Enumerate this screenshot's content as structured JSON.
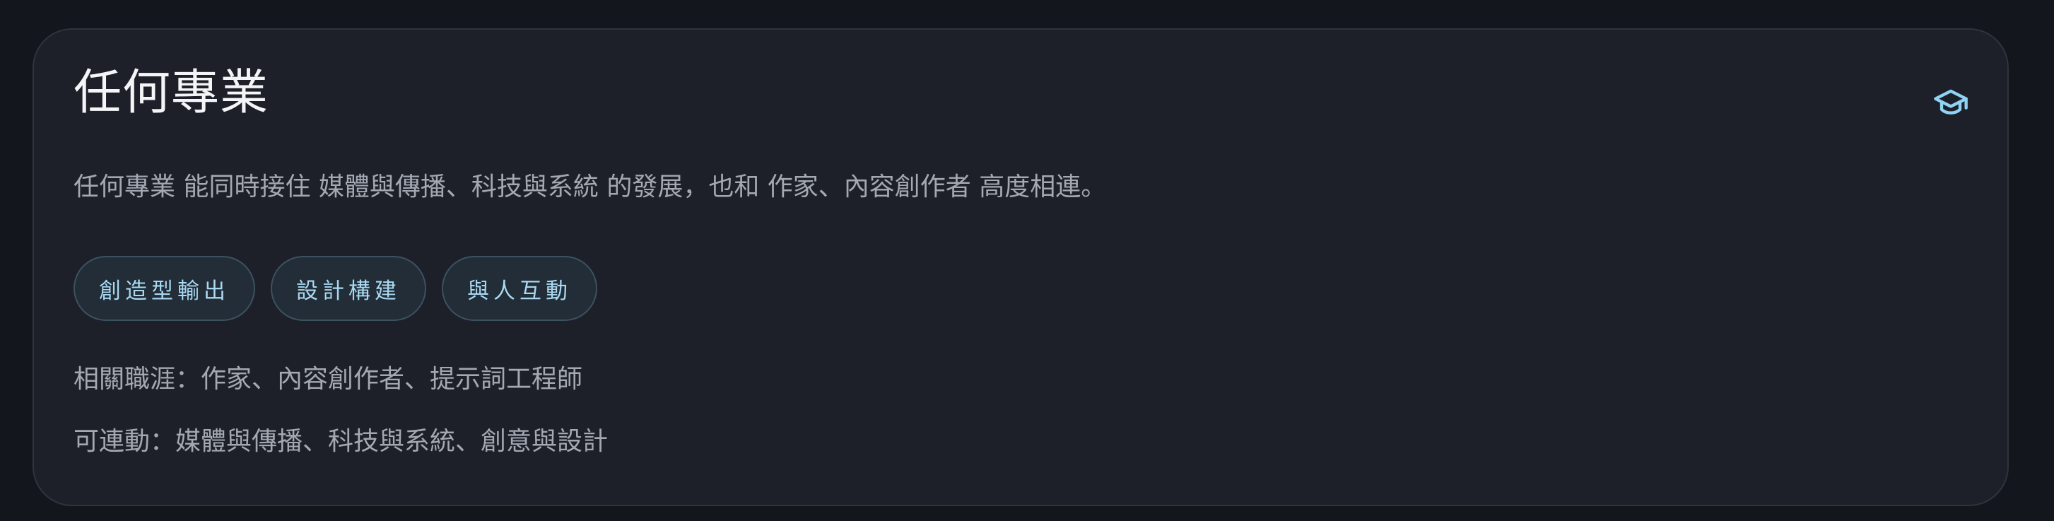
{
  "card": {
    "title": "任何專業",
    "icon": "graduation-cap-icon",
    "accent_color": "#8fd3f5",
    "description": "任何專業 能同時接住 媒體與傳播、科技與系統 的發展，也和 作家、內容創作者 高度相連。",
    "tags": [
      {
        "label": "創造型輸出"
      },
      {
        "label": "設計構建"
      },
      {
        "label": "與人互動"
      }
    ],
    "related_careers": "相關職涯：作家、內容創作者、提示詞工程師",
    "linkable": "可連動：媒體與傳播、科技與系統、創意與設計"
  }
}
